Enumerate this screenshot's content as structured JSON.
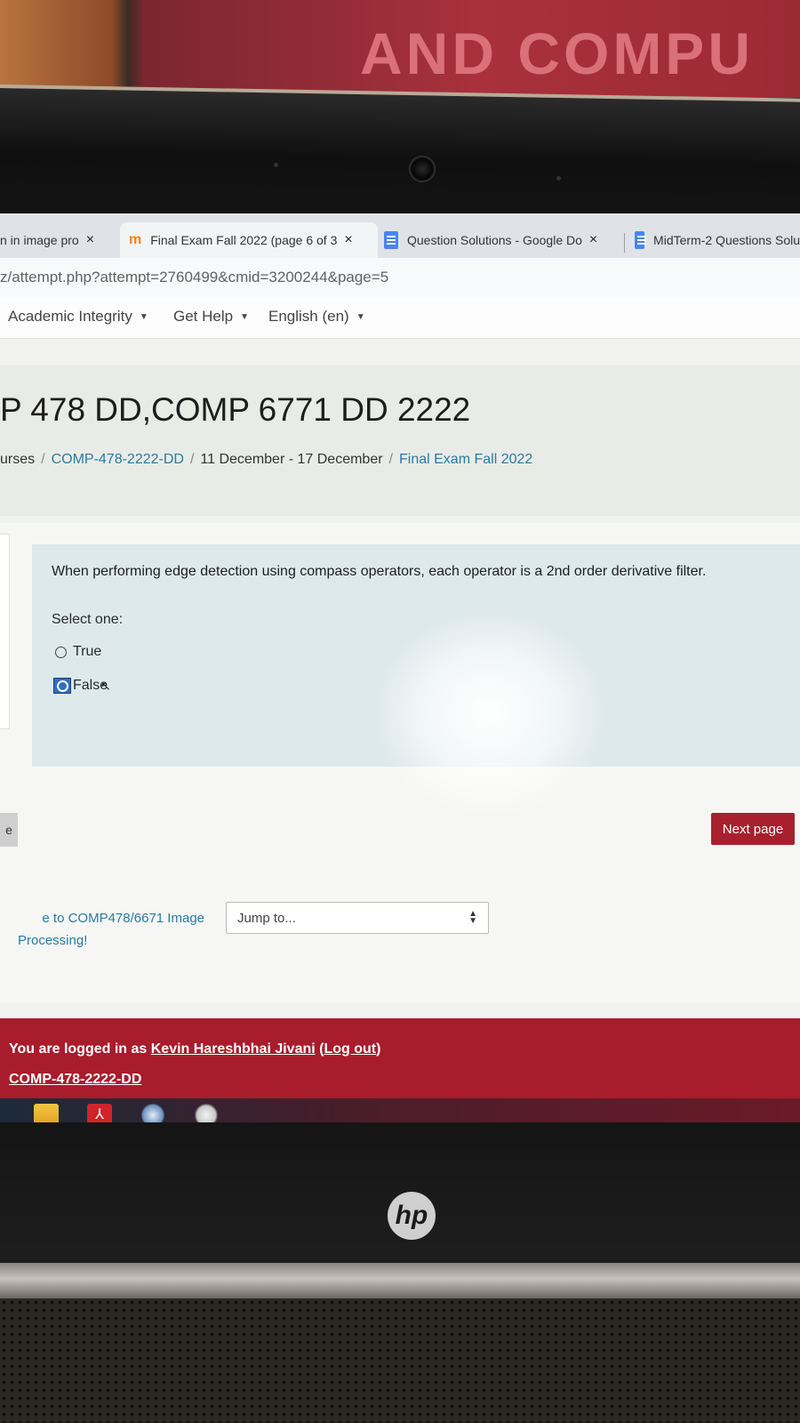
{
  "poster": {
    "text": "AND COMPU"
  },
  "browser": {
    "tabs": [
      {
        "label": "n in image pro",
        "close": "×"
      },
      {
        "label": "Final Exam Fall 2022 (page 6 of 3",
        "close": "×"
      },
      {
        "label": "Question Solutions - Google Do",
        "close": "×"
      },
      {
        "label": "MidTerm-2 Questions Solu"
      }
    ],
    "url": "z/attempt.php?attempt=2760499&cmid=3200244&page=5"
  },
  "navbar": {
    "items": [
      {
        "label": "Academic Integrity"
      },
      {
        "label": "Get Help"
      },
      {
        "label": "English (en)"
      }
    ]
  },
  "header": {
    "course_title": "P 478 DD,COMP 6771 DD 2222",
    "breadcrumb": [
      "urses",
      "COMP-478-2222-DD",
      "11 December - 17 December",
      "Final Exam Fall 2022"
    ]
  },
  "question": {
    "text": "When performing edge detection using compass operators, each operator is a 2nd order derivative filter.",
    "select_label": "Select one:",
    "options": [
      {
        "label": "True",
        "selected": false
      },
      {
        "label": "False",
        "selected": true
      }
    ]
  },
  "navigation": {
    "prev_stub": "e",
    "next_label": "Next page"
  },
  "footer": {
    "welcome_line1": "e to COMP478/6671 Image",
    "welcome_line2": "Processing!",
    "jump_placeholder": "Jump to...",
    "logged_prefix": "You are logged in as ",
    "user_name": "Kevin Hareshbhai Jivani",
    "logout_open": " (",
    "logout_label": "Log out",
    "logout_close": ")",
    "course_link": "COMP-478-2222-DD"
  },
  "laptop": {
    "brand": "hp"
  },
  "colors": {
    "accent_red": "#a8202e",
    "link_blue": "#2b7aa3",
    "question_bg": "#dde9eb",
    "radio_selected": "#2f6fc0"
  },
  "icons": {
    "taskbar": [
      "file-explorer-icon",
      "acrobat-icon",
      "snipping-tool-icon",
      "app-icon"
    ]
  }
}
